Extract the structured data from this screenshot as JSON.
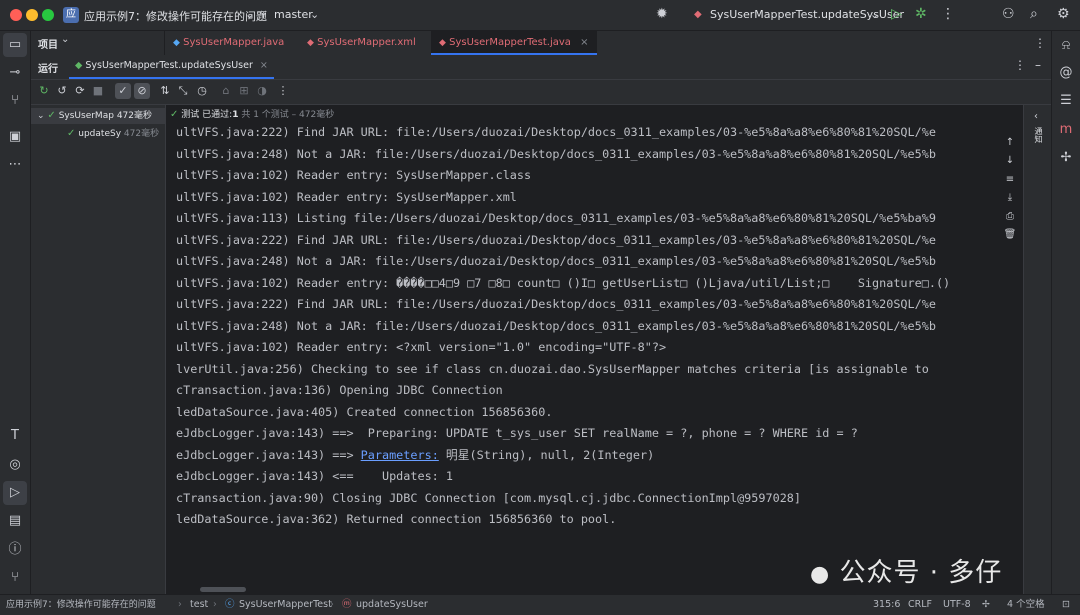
{
  "window": {
    "project_badge": "应",
    "project_name": "应用示例7：修改操作可能存在的问题",
    "branch": "master",
    "run_config": "SysUserMapperTest.updateSysUser"
  },
  "project_panel": {
    "label": "项目"
  },
  "tabs": [
    {
      "label": "SysUserMapper.java",
      "color": "#e06c75"
    },
    {
      "label": "SysUserMapper.xml",
      "color": "#e06c75"
    },
    {
      "label": "SysUserMapperTest.java",
      "color": "#e06c75"
    }
  ],
  "run_panel": {
    "label": "运行",
    "tab": "SysUserMapperTest.updateSysUser"
  },
  "test_status": {
    "prefix": "测试",
    "passed_label": "已通过:",
    "passed_count": "1",
    "detail": "共 1 个测试 – 472毫秒"
  },
  "tree": {
    "root": {
      "name": "SysUserMap",
      "time": "472毫秒"
    },
    "child": {
      "name": "updateSy",
      "time": "472毫秒"
    }
  },
  "console_lines": [
    "ultVFS.java:222) Find JAR URL: file:/Users/duozai/Desktop/docs_0311_examples/03-%e5%8a%a8%e6%80%81%20SQL/%e",
    "ultVFS.java:248) Not a JAR: file:/Users/duozai/Desktop/docs_0311_examples/03-%e5%8a%a8%e6%80%81%20SQL/%e5%b",
    "ultVFS.java:102) Reader entry: SysUserMapper.class",
    "ultVFS.java:102) Reader entry: SysUserMapper.xml",
    "ultVFS.java:113) Listing file:/Users/duozai/Desktop/docs_0311_examples/03-%e5%8a%a8%e6%80%81%20SQL/%e5%ba%9",
    "ultVFS.java:222) Find JAR URL: file:/Users/duozai/Desktop/docs_0311_examples/03-%e5%8a%a8%e6%80%81%20SQL/%e",
    "ultVFS.java:248) Not a JAR: file:/Users/duozai/Desktop/docs_0311_examples/03-%e5%8a%a8%e6%80%81%20SQL/%e5%b",
    "ultVFS.java:102) Reader entry: ����□□4□9 □7 □8□ count□ ()I□ getUserList□ ()Ljava/util/List;□    Signature□.()",
    "ultVFS.java:222) Find JAR URL: file:/Users/duozai/Desktop/docs_0311_examples/03-%e5%8a%a8%e6%80%81%20SQL/%e",
    "ultVFS.java:248) Not a JAR: file:/Users/duozai/Desktop/docs_0311_examples/03-%e5%8a%a8%e6%80%81%20SQL/%e5%b",
    "ultVFS.java:102) Reader entry: <?xml version=\"1.0\" encoding=\"UTF-8\"?>",
    "lverUtil.java:256) Checking to see if class cn.duozai.dao.SysUserMapper matches criteria [is assignable to",
    "cTransaction.java:136) Opening JDBC Connection",
    "ledDataSource.java:405) Created connection 156856360.",
    "eJdbcLogger.java:143) ==>  Preparing: UPDATE t_sys_user SET realName = ?, phone = ? WHERE id = ?"
  ],
  "param_line": {
    "prefix": "eJdbcLogger.java:143) ==> ",
    "link": "Parameters:",
    "rest": " 明星(String), null, 2(Integer)"
  },
  "console_lines_tail": [
    "eJdbcLogger.java:143) <==    Updates: 1",
    "cTransaction.java:90) Closing JDBC Connection [com.mysql.cj.jdbc.ConnectionImpl@9597028]",
    "ledDataSource.java:362) Returned connection 156856360 to pool."
  ],
  "side_label": "通知",
  "statusbar": {
    "breadcrumb": [
      "应用示例7：修改操作可能存在的问题",
      "test",
      "SysUserMapperTest",
      "updateSysUser"
    ],
    "position": "315:6",
    "line_sep": "CRLF",
    "encoding": "UTF-8",
    "indent": "4 个空格"
  },
  "watermark": "公众号 · 多仔"
}
